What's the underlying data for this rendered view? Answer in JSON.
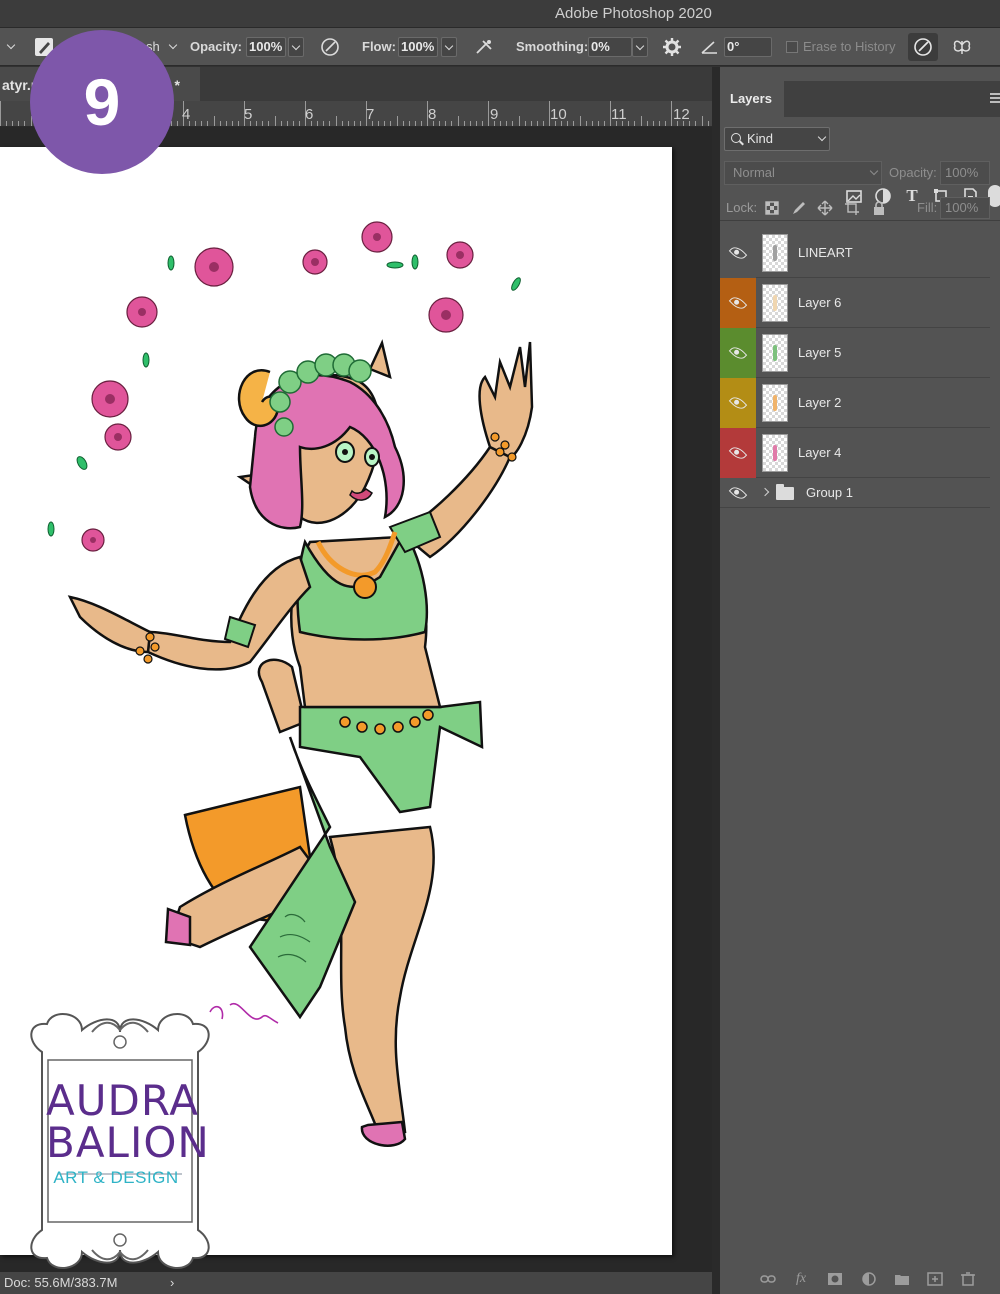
{
  "app": {
    "title": "Adobe Photoshop 2020"
  },
  "options_bar": {
    "brush_label": "sh",
    "opacity_label": "Opacity:",
    "opacity_value": "100%",
    "flow_label": "Flow:",
    "flow_value": "100%",
    "smoothing_label": "Smoothing:",
    "smoothing_value": "0%",
    "angle_value": "0°",
    "erase_to_history": "Erase to History"
  },
  "document": {
    "tab_left": "atyr.p",
    "tab_right": ") *",
    "ruler_numbers": [
      "4",
      "5",
      "6",
      "7",
      "8",
      "9",
      "10",
      "11",
      "12"
    ]
  },
  "status": {
    "doc_size": "Doc: 55.6M/383.7M",
    "arrow": "›"
  },
  "layers_panel": {
    "tab_label": "Layers",
    "filter_kind": "Kind",
    "blend_mode": "Normal",
    "opacity_label": "Opacity:",
    "opacity_value": "100%",
    "lock_label": "Lock:",
    "fill_label": "Fill:",
    "fill_value": "100%",
    "layers": [
      {
        "name": "LINEART",
        "eye_color": "#535353",
        "thumb_mark": "#a0a0a0"
      },
      {
        "name": "Layer 6",
        "eye_color": "#b45f13",
        "thumb_mark": "#f0d6b0"
      },
      {
        "name": "Layer 5",
        "eye_color": "#5b8c2e",
        "thumb_mark": "#7cc07c"
      },
      {
        "name": "Layer 2",
        "eye_color": "#b38d15",
        "thumb_mark": "#f0b36a"
      },
      {
        "name": "Layer 4",
        "eye_color": "#b33a3a",
        "thumb_mark": "#e07aa8"
      }
    ],
    "group_name": "Group 1",
    "bottom_icons": [
      "link-icon",
      "fx-icon",
      "mask-icon",
      "adjustment-icon",
      "folder-icon",
      "new-layer-icon",
      "trash-icon"
    ]
  },
  "overlay": {
    "step_number": "9",
    "logo_line1": "AUDRA",
    "logo_line2": "BALION",
    "logo_line3": "ART & DESIGN"
  },
  "colors": {
    "badge": "#7e57aa",
    "logo_purple": "#5b2d8c",
    "logo_teal": "#2fb3c6",
    "skin": "#e8b98a",
    "hair": "#e073b3",
    "outfit_green": "#7fcf85",
    "skirt_orange": "#f39a2a",
    "flowers": "#e0559a"
  }
}
